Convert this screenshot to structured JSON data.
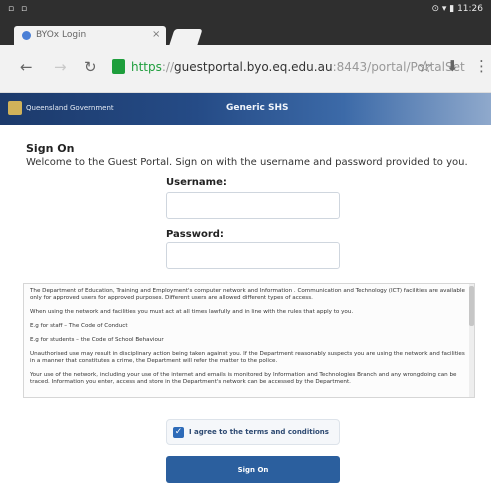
{
  "statusbar": {
    "left_icons": "▫ ▫",
    "right": "⊙ ▾ ▮ 11:26"
  },
  "browser": {
    "tab_title": "BYOx Login",
    "tab_close": "×",
    "url": {
      "scheme": "https",
      "sep": "://",
      "host": "guestportal.byo.eq.edu.au",
      "path": ":8443/portal/PortalSet"
    }
  },
  "site": {
    "gov_name": "Queensland Government",
    "name": "Generic SHS"
  },
  "main": {
    "title": "Sign On",
    "welcome": "Welcome to the Guest Portal. Sign on with the username and password provided to you.",
    "username_label": "Username:",
    "password_label": "Password:",
    "terms": [
      "The Department of Education, Training and Employment's computer network and Information . Communication and Technology (ICT) facilities are available only for approved users for approved purposes. Different users are allowed different types of access.",
      "When using the network and facilities you must act at all times lawfully and in line with the rules that apply to you.",
      "E.g for staff – The Code of Conduct",
      "E.g for students – the Code of School Behaviour",
      "Unauthorised use may result in disciplinary action being taken against you. If the Department reasonably suspects you are using the network and facilities in a manner that constitutes a crime, the Department will refer the matter to the police.",
      "Your use of the network, including your use of the internet and emails is monitored by Information and Technologies Branch and any wrongdoing can be traced. Information you enter, access and store in the Department's network can be accessed by the Department."
    ],
    "agree_label": "I agree to the terms and conditions",
    "signon_button": "Sign On"
  },
  "colors": {
    "accent": "#2b5f9e",
    "header": "#1c3a6b",
    "secure": "#1e9e3c"
  }
}
